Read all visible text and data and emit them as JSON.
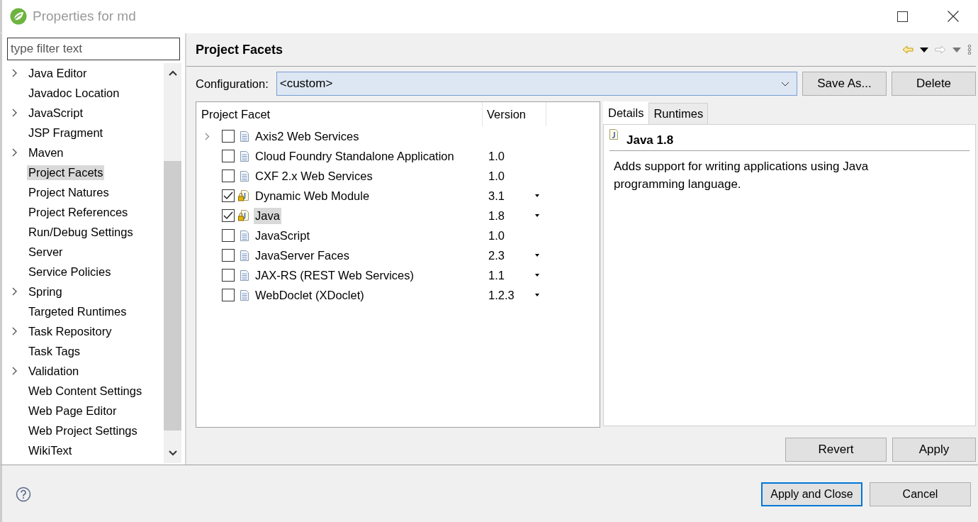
{
  "window": {
    "title": "Properties for md"
  },
  "filter": {
    "placeholder": "type filter text"
  },
  "sidebar": {
    "items": [
      {
        "label": "Java Editor",
        "expandable": true,
        "selected": false
      },
      {
        "label": "Javadoc Location",
        "expandable": false,
        "selected": false
      },
      {
        "label": "JavaScript",
        "expandable": true,
        "selected": false
      },
      {
        "label": "JSP Fragment",
        "expandable": false,
        "selected": false
      },
      {
        "label": "Maven",
        "expandable": true,
        "selected": false
      },
      {
        "label": "Project Facets",
        "expandable": false,
        "selected": true
      },
      {
        "label": "Project Natures",
        "expandable": false,
        "selected": false
      },
      {
        "label": "Project References",
        "expandable": false,
        "selected": false
      },
      {
        "label": "Run/Debug Settings",
        "expandable": false,
        "selected": false
      },
      {
        "label": "Server",
        "expandable": false,
        "selected": false
      },
      {
        "label": "Service Policies",
        "expandable": false,
        "selected": false
      },
      {
        "label": "Spring",
        "expandable": true,
        "selected": false
      },
      {
        "label": "Targeted Runtimes",
        "expandable": false,
        "selected": false
      },
      {
        "label": "Task Repository",
        "expandable": true,
        "selected": false
      },
      {
        "label": "Task Tags",
        "expandable": false,
        "selected": false
      },
      {
        "label": "Validation",
        "expandable": true,
        "selected": false
      },
      {
        "label": "Web Content Settings",
        "expandable": false,
        "selected": false
      },
      {
        "label": "Web Page Editor",
        "expandable": false,
        "selected": false
      },
      {
        "label": "Web Project Settings",
        "expandable": false,
        "selected": false
      },
      {
        "label": "WikiText",
        "expandable": false,
        "selected": false
      }
    ]
  },
  "page": {
    "title": "Project Facets"
  },
  "configuration": {
    "label": "Configuration:",
    "value": "<custom>"
  },
  "config_buttons": [
    "Save As...",
    "Delete"
  ],
  "facets": {
    "columns": [
      "Project Facet",
      "Version"
    ],
    "rows": [
      {
        "name": "Axis2 Web Services",
        "version": "",
        "checked": false,
        "expandable": true,
        "locked": false,
        "has_version_menu": false,
        "selected": false
      },
      {
        "name": "Cloud Foundry Standalone Application",
        "version": "1.0",
        "checked": false,
        "expandable": false,
        "locked": false,
        "has_version_menu": false,
        "selected": false
      },
      {
        "name": "CXF 2.x Web Services",
        "version": "1.0",
        "checked": false,
        "expandable": false,
        "locked": false,
        "has_version_menu": false,
        "selected": false
      },
      {
        "name": "Dynamic Web Module",
        "version": "3.1",
        "checked": true,
        "expandable": false,
        "locked": true,
        "has_version_menu": true,
        "selected": false
      },
      {
        "name": "Java",
        "version": "1.8",
        "checked": true,
        "expandable": false,
        "locked": true,
        "has_version_menu": true,
        "selected": true
      },
      {
        "name": "JavaScript",
        "version": "1.0",
        "checked": false,
        "expandable": false,
        "locked": false,
        "has_version_menu": false,
        "selected": false
      },
      {
        "name": "JavaServer Faces",
        "version": "2.3",
        "checked": false,
        "expandable": false,
        "locked": false,
        "has_version_menu": true,
        "selected": false
      },
      {
        "name": "JAX-RS (REST Web Services)",
        "version": "1.1",
        "checked": false,
        "expandable": false,
        "locked": false,
        "has_version_menu": true,
        "selected": false
      },
      {
        "name": "WebDoclet (XDoclet)",
        "version": "1.2.3",
        "checked": false,
        "expandable": false,
        "locked": false,
        "has_version_menu": true,
        "selected": false
      }
    ]
  },
  "details": {
    "tabs": [
      {
        "label": "Details",
        "selected": true
      },
      {
        "label": "Runtimes",
        "selected": false
      }
    ],
    "heading": "Java 1.8",
    "description": "Adds support for writing applications using Java programming language."
  },
  "page_buttons": [
    "Revert",
    "Apply"
  ],
  "footer_buttons": [
    {
      "label": "Apply and Close",
      "default": true
    },
    {
      "label": "Cancel",
      "default": false
    }
  ]
}
